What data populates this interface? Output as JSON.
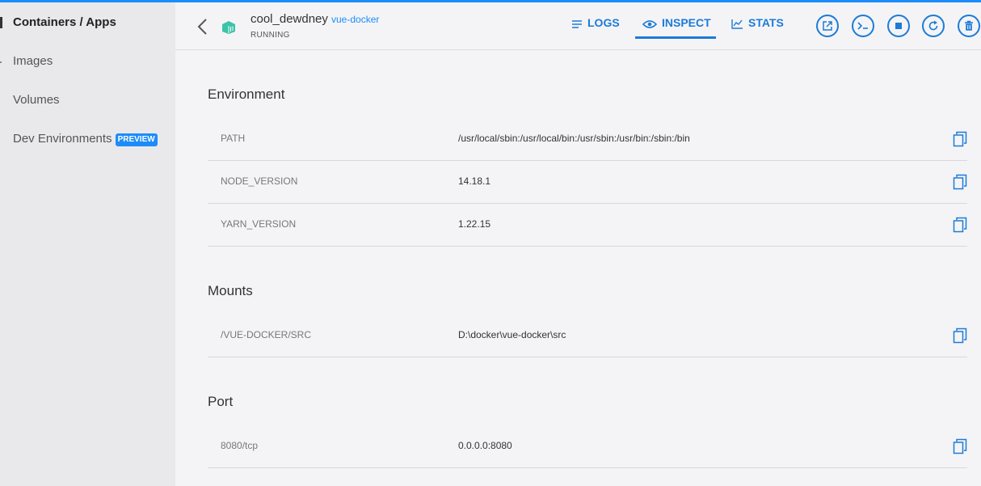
{
  "sidebar": {
    "items": [
      {
        "label": "Containers / Apps",
        "active": true
      },
      {
        "label": "Images",
        "active": false
      },
      {
        "label": "Volumes",
        "active": false
      },
      {
        "label": "Dev Environments",
        "active": false,
        "badge": "PREVIEW"
      }
    ]
  },
  "header": {
    "container_name": "cool_dewdney",
    "image_name": "vue-docker",
    "status": "RUNNING",
    "tabs": [
      {
        "label": "LOGS",
        "icon": "logs-icon"
      },
      {
        "label": "INSPECT",
        "icon": "eye-icon",
        "active": true
      },
      {
        "label": "STATS",
        "icon": "chart-icon"
      }
    ],
    "actions": [
      "open-in-browser-icon",
      "cli-icon",
      "stop-icon",
      "restart-icon",
      "delete-icon"
    ]
  },
  "environment": {
    "title": "Environment",
    "rows": [
      {
        "key": "PATH",
        "value": "/usr/local/sbin:/usr/local/bin:/usr/sbin:/usr/bin:/sbin:/bin"
      },
      {
        "key": "NODE_VERSION",
        "value": "14.18.1"
      },
      {
        "key": "YARN_VERSION",
        "value": "1.22.15"
      }
    ]
  },
  "mounts": {
    "title": "Mounts",
    "rows": [
      {
        "key": "/VUE-DOCKER/SRC",
        "value": "D:\\docker\\vue-docker\\src"
      }
    ]
  },
  "port": {
    "title": "Port",
    "rows": [
      {
        "key": "8080/tcp",
        "value": "0.0.0.0:8080"
      }
    ]
  },
  "colors": {
    "accent": "#1d7bd6",
    "topline": "#1d8cf8",
    "sidebar_bg": "#e9e9ec",
    "content_bg": "#f4f4f6"
  }
}
